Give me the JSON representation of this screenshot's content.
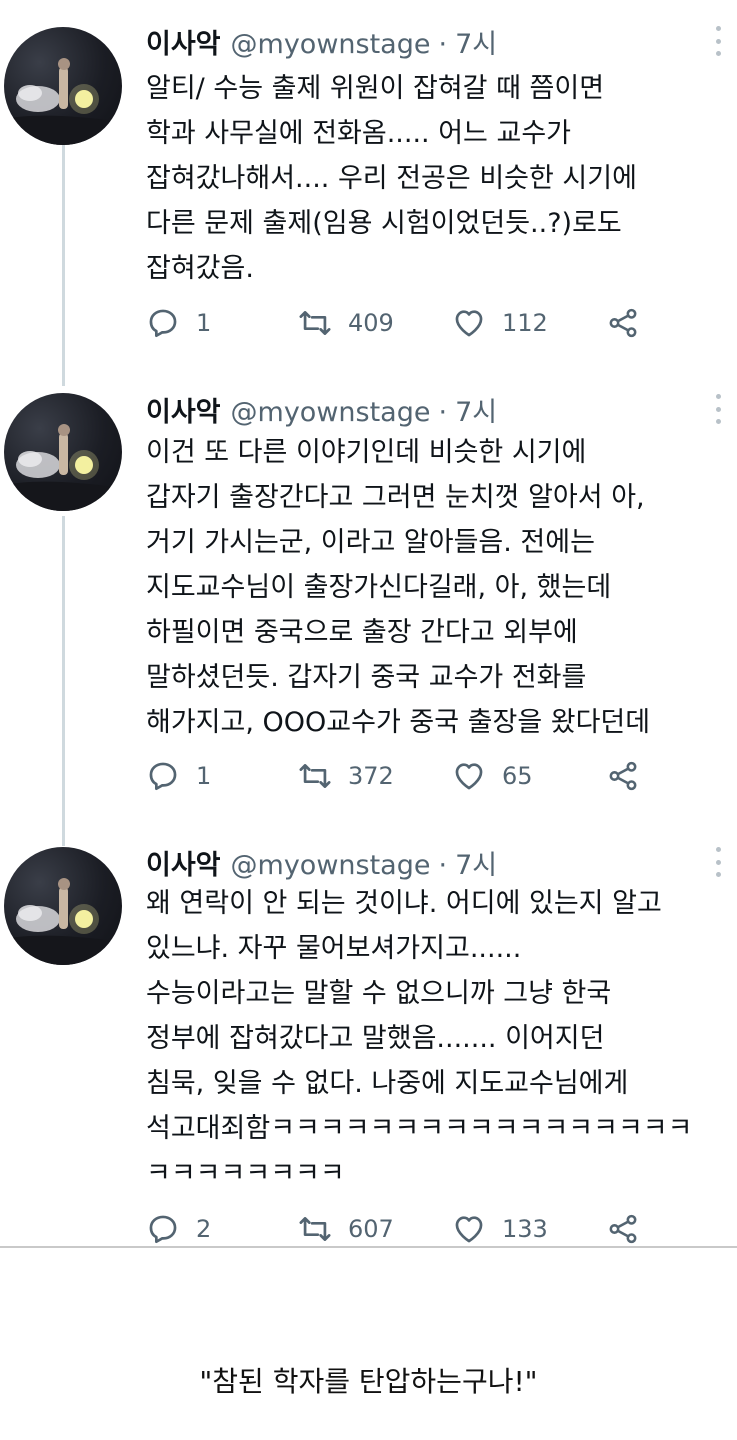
{
  "tweets": [
    {
      "name": "이사악",
      "handle": "@myownstage",
      "separator": "·",
      "time": "7시",
      "lines": [
        "알티/ 수능 출제 위원이 잡혀갈 때 쯤이면",
        "학과 사무실에 전화옴..... 어느 교수가",
        "잡혀갔나해서.... 우리 전공은 비슷한 시기에",
        "다른 문제 출제(임용 시험이었던듯..?)로도",
        "잡혀갔음."
      ],
      "replies": "1",
      "retweets": "409",
      "likes": "112"
    },
    {
      "name": "이사악",
      "handle": "@myownstage",
      "separator": "·",
      "time": "7시",
      "lines": [
        "이건 또 다른 이야기인데 비슷한 시기에",
        "갑자기 출장간다고 그러면 눈치껏 알아서 아,",
        "거기 가시는군, 이라고 알아들음. 전에는",
        "지도교수님이 출장가신다길래, 아, 했는데",
        "하필이면 중국으로 출장 간다고 외부에",
        "말하셨던듯. 갑자기 중국 교수가 전화를",
        "해가지고, OOO교수가 중국 출장을 왔다던데"
      ],
      "replies": "1",
      "retweets": "372",
      "likes": "65"
    },
    {
      "name": "이사악",
      "handle": "@myownstage",
      "separator": "·",
      "time": "7시",
      "lines": [
        "왜 연락이 안 되는 것이냐. 어디에 있는지 알고",
        "있느냐. 자꾸 물어보셔가지고......",
        "수능이라고는 말할 수 없으니까 그냥 한국",
        "정부에 잡혀갔다고 말했음....... 이어지던",
        "침묵, 잊을 수 없다. 나중에 지도교수님에게",
        "석고대죄함ㅋㅋㅋㅋㅋㅋㅋㅋㅋㅋㅋㅋㅋㅋㅋㅋㅋ",
        "ㅋㅋㅋㅋㅋㅋㅋㅋ"
      ],
      "replies": "2",
      "retweets": "607",
      "likes": "133"
    }
  ],
  "caption": "\"참된 학자를 탄압하는구나!\"",
  "icons": [
    "reply-icon",
    "retweet-icon",
    "like-icon",
    "share-icon",
    "more-icon"
  ],
  "colors": {
    "text": "#0f1419",
    "secondary": "#536471",
    "thread_line": "#cfd9de"
  }
}
